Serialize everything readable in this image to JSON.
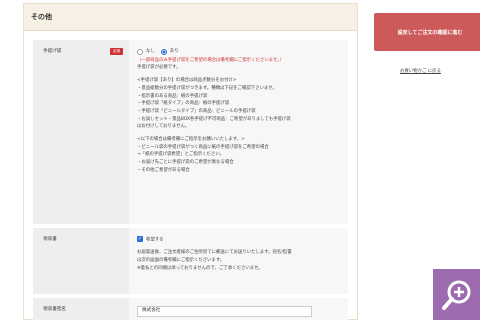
{
  "section": {
    "title": "その他"
  },
  "handbag": {
    "label": "手提げ袋",
    "required_badge": "必須",
    "option_none": "なし",
    "option_yes": "あり",
    "selected": "あり",
    "note_red": "（一部商品のみ手提げ袋をご希望の場合は備考欄にご指示くださいませ。）",
    "line_required": "手提げ袋が必要です。",
    "details": [
      "<手提げ袋【あり】の場合は商品点数分をお付け>",
      "・景品総数分の手提げ袋がつきます。種類は下記をご確認下さいませ。",
      "・指示書のある商品：紙の手提げ袋",
      "・手提げ袋「紙タイプ」の商品：紙の手提げ袋",
      "・手提げ袋「ビニールタイプ」の商品：ビニールの手提げ袋",
      "・お試しセット・景品BOX各手提げ不可商品：ご希望がありましても手提げ袋",
      "はお付けしておりません。"
    ],
    "details2": [
      "<以下の場合は備考欄にご指示をお願いいたします。>",
      "・ビニール袋の手提げ袋がつく商品に紙の手提げ袋をご希望の場合",
      "→「紙の手提げ袋希望」とご指示ください。",
      "・お届け先ごとに手提げ袋のご希望が異なる場合",
      "・その他ご希望がある場合"
    ]
  },
  "receipt": {
    "label": "領収書",
    "checkbox_label": "希望する",
    "lines": [
      "お届発送後、ご注文者様のご住所宛てに郵送にてお送りいたします。宛名/但書",
      "は次の画面の備考欄にご指示くださいます。",
      "※着払との同梱は承っておりませんので、ご了承くださいませ。"
    ]
  },
  "receipt_name": {
    "label": "領収書宛名",
    "value": "株式会社"
  },
  "sidebar": {
    "confirm_button": "設定してご注文の確認に進む",
    "continue_link": "お買い物かご に戻る"
  },
  "icons": {
    "zoom": "zoom-in-icon"
  },
  "colors": {
    "accent": "#cc5a5a",
    "zoom_bg": "#9c6bb0",
    "required": "#cc3333",
    "check": "#2a6fd6"
  }
}
